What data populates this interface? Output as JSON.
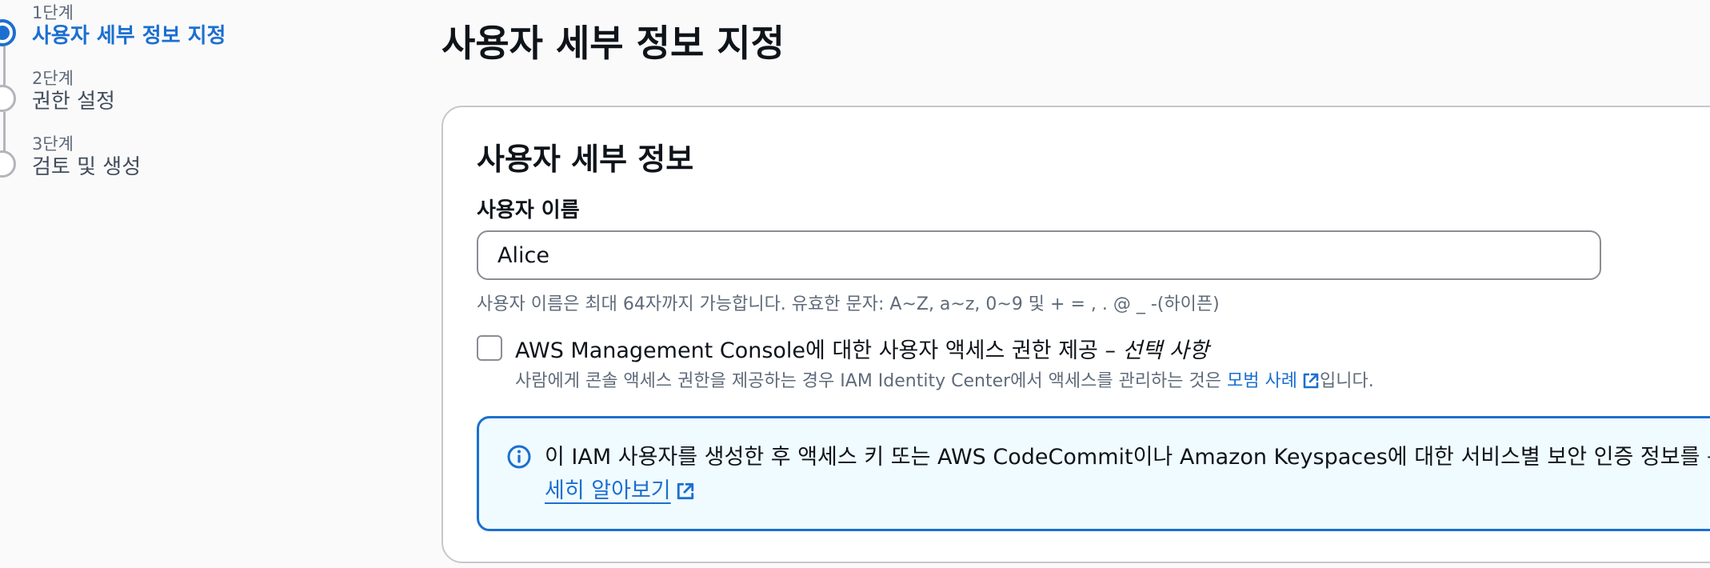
{
  "steps": [
    {
      "number": "1단계",
      "label": "사용자 세부 정보 지정",
      "state": "active"
    },
    {
      "number": "2단계",
      "label": "권한 설정",
      "state": "pending"
    },
    {
      "number": "3단계",
      "label": "검토 및 생성",
      "state": "pending"
    }
  ],
  "page_title": "사용자 세부 정보 지정",
  "panel": {
    "title": "사용자 세부 정보",
    "username_label": "사용자 이름",
    "username_value": "Alice",
    "username_constraint": "사용자 이름은 최대 64자까지 가능합니다. 유효한 문자: A~Z, a~z, 0~9 및 + = , . @ _ -(하이픈)",
    "console_access": {
      "checked": false,
      "label_main": "AWS Management Console에 대한 사용자 액세스 권한 제공 – ",
      "label_optional": "선택 사항",
      "desc_before": "사람에게 콘솔 액세스 권한을 제공하는 경우 IAM Identity Center에서 액세스를 관리하는 것은 ",
      "desc_link": "모범 사례",
      "desc_after": "입니다."
    },
    "info_alert": {
      "text": "이 IAM 사용자를 생성한 후 액세스 키 또는 AWS CodeCommit이나 Amazon Keyspaces에 대한 서비스별 보안 인증 정보를 통해 프",
      "link": "세히 알아보기"
    }
  },
  "colors": {
    "accent": "#1c6fd0",
    "info_background": "#f0fbff",
    "muted_text": "#5f6b7a",
    "border": "#c6c6cd"
  },
  "icons": {
    "external_link": "external-link-icon",
    "info": "info-icon",
    "step_active": "radio-active-icon",
    "step_pending": "radio-empty-icon"
  }
}
